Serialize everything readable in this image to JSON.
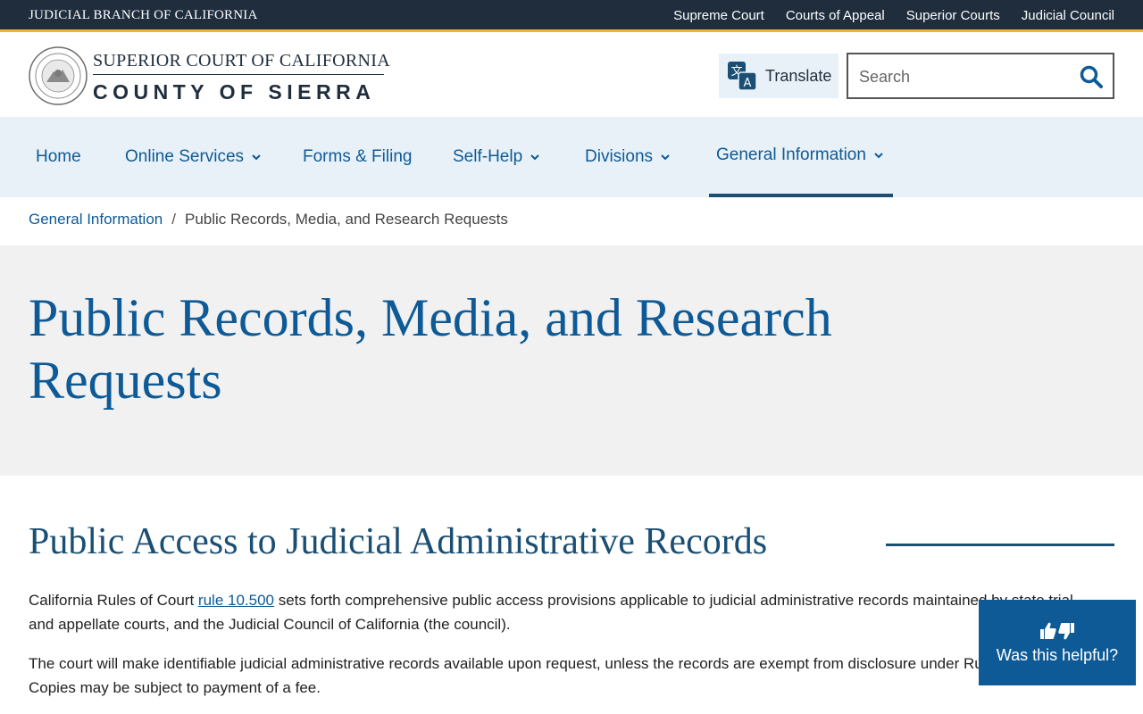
{
  "topbar": {
    "brand": "JUDICIAL BRANCH OF CALIFORNIA",
    "links": [
      "Supreme Court",
      "Courts of Appeal",
      "Superior Courts",
      "Judicial Council"
    ]
  },
  "header": {
    "court_line1": "SUPERIOR COURT OF CALIFORNIA",
    "court_line2": "COUNTY OF SIERRA",
    "translate_label": "Translate",
    "search_placeholder": "Search"
  },
  "nav": {
    "items": [
      {
        "label": "Home",
        "has_menu": false
      },
      {
        "label": "Online Services",
        "has_menu": true
      },
      {
        "label": "Forms & Filing",
        "has_menu": false
      },
      {
        "label": "Self-Help",
        "has_menu": true
      },
      {
        "label": "Divisions",
        "has_menu": true
      },
      {
        "label": "General Information",
        "has_menu": true,
        "active": true
      }
    ]
  },
  "breadcrumb": {
    "parent": "General Information",
    "separator": "/",
    "current": "Public Records, Media, and Research Requests"
  },
  "page": {
    "title": "Public Records, Media, and Research Requests",
    "section_title": "Public Access to Judicial Administrative Records",
    "p1_before": "California Rules of Court ",
    "p1_link": "rule 10.500",
    "p1_after": " sets forth comprehensive public access provisions applicable to judicial administrative records maintained by state trial and appellate courts, and the Judicial Council of California (the council).",
    "p2": "The court will make identifiable judicial administrative records available upon request, unless the records are exempt from disclosure under Rule 10.500. Copies may be subject to payment of a fee."
  },
  "feedback": {
    "label": "Was this helpful?"
  },
  "colors": {
    "topbar_bg": "#1f2d3d",
    "accent_gold": "#f2b233",
    "link_blue": "#0e5a96",
    "nav_bg": "#e8f1f8",
    "hero_bg": "#f1f1f1"
  }
}
